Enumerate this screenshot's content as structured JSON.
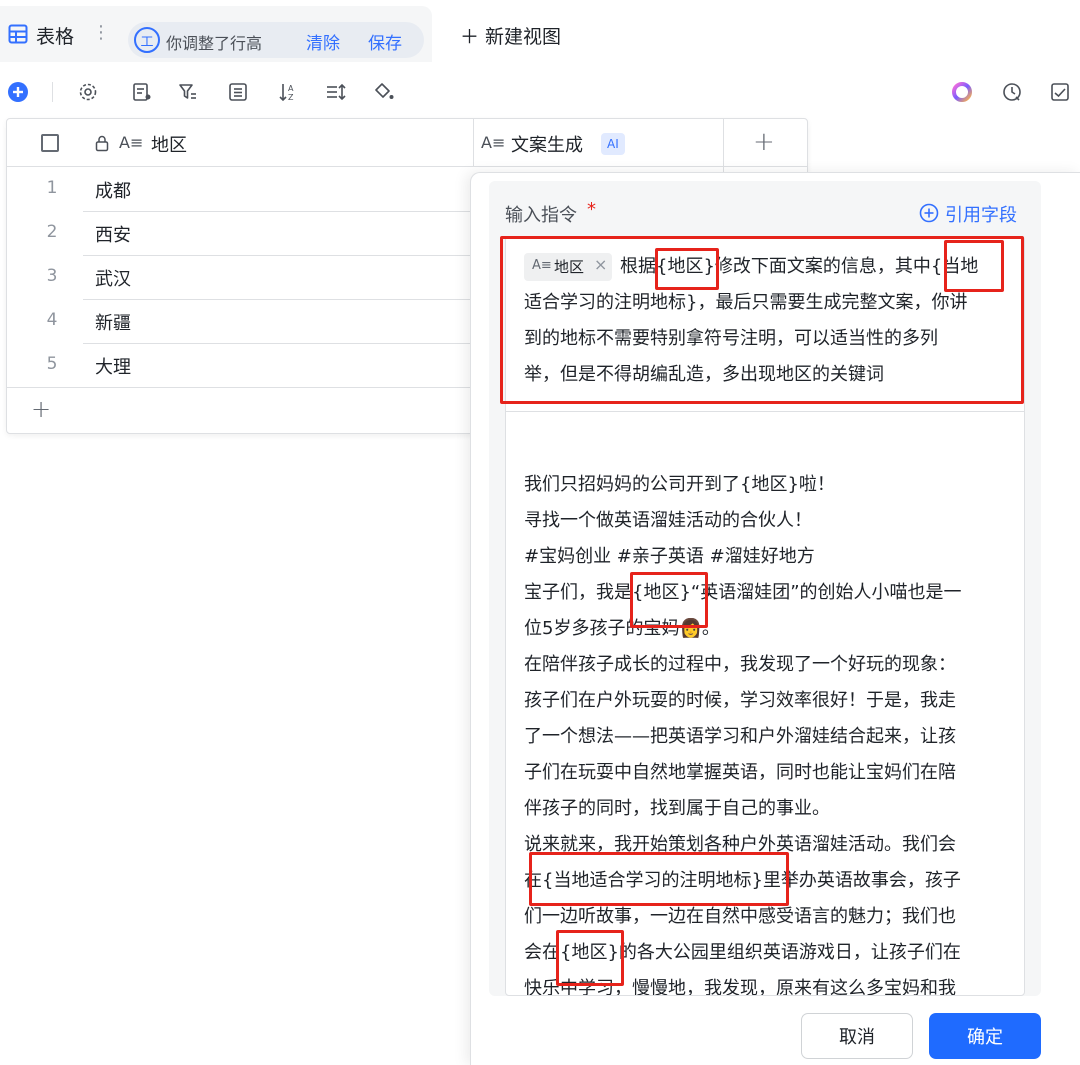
{
  "view_tab": {
    "title": "表格",
    "more": "⋮",
    "chip_icon_label": "工",
    "chip_text": "你调整了行高",
    "clear_label": "清除",
    "save_label": "保存"
  },
  "new_view_label": "＋ 新建视图",
  "table": {
    "col1_header": "地区",
    "col2_header": "文案生成",
    "ai_badge": "AI",
    "add_col": "+",
    "add_row": "+",
    "rows": [
      {
        "num": "1",
        "value": "成都"
      },
      {
        "num": "2",
        "value": "西安"
      },
      {
        "num": "3",
        "value": "武汉"
      },
      {
        "num": "4",
        "value": "新疆"
      },
      {
        "num": "5",
        "value": "大理"
      }
    ]
  },
  "panel": {
    "label": "输入指令",
    "required_mark": "*",
    "ref_field": "引用字段",
    "field_tag": "地区",
    "field_tag_close": "×",
    "instruction_lines": [
      "根据{地区}修改下面文案的信息，其中{当地",
      "适合学习的注明地标}，最后只需要生成完整文案，你讲",
      "到的地标不需要特别拿符号注明，可以适当性的多列",
      "举，但是不得胡编乱造，多出现地区的关键词"
    ],
    "body_lines": [
      "我们只招妈妈的公司开到了{地区}啦！",
      "寻找一个做英语溜娃活动的合伙人！",
      "#宝妈创业 #亲子英语 #溜娃好地方",
      "宝子们，我是{地区}“英语溜娃团”的创始人小喵也是一",
      "位5岁多孩子的宝妈👩。",
      "在陪伴孩子成长的过程中，我发现了一个好玩的现象：",
      "孩子们在户外玩耍的时候，学习效率很好！于是，我走",
      "了一个想法——把英语学习和户外溜娃结合起来，让孩",
      "子们在玩耍中自然地掌握英语，同时也能让宝妈们在陪",
      "伴孩子的同时，找到属于自己的事业。",
      "说来就来，我开始策划各种户外英语溜娃活动。我们会",
      "在{当地适合学习的注明地标}里举办英语故事会，孩子",
      "们一边听故事，一边在自然中感受语言的魅力；我们也",
      "会在{地区}的各大公园里组织英语游戏日，让孩子们在",
      "快乐中学习，慢慢地，我发现，原来有这么多宝妈和我"
    ],
    "cancel_label": "取消",
    "confirm_label": "确定"
  },
  "colors": {
    "accent": "#3370ff",
    "highlight": "#e6231b",
    "primary_button": "#1f6bff"
  }
}
